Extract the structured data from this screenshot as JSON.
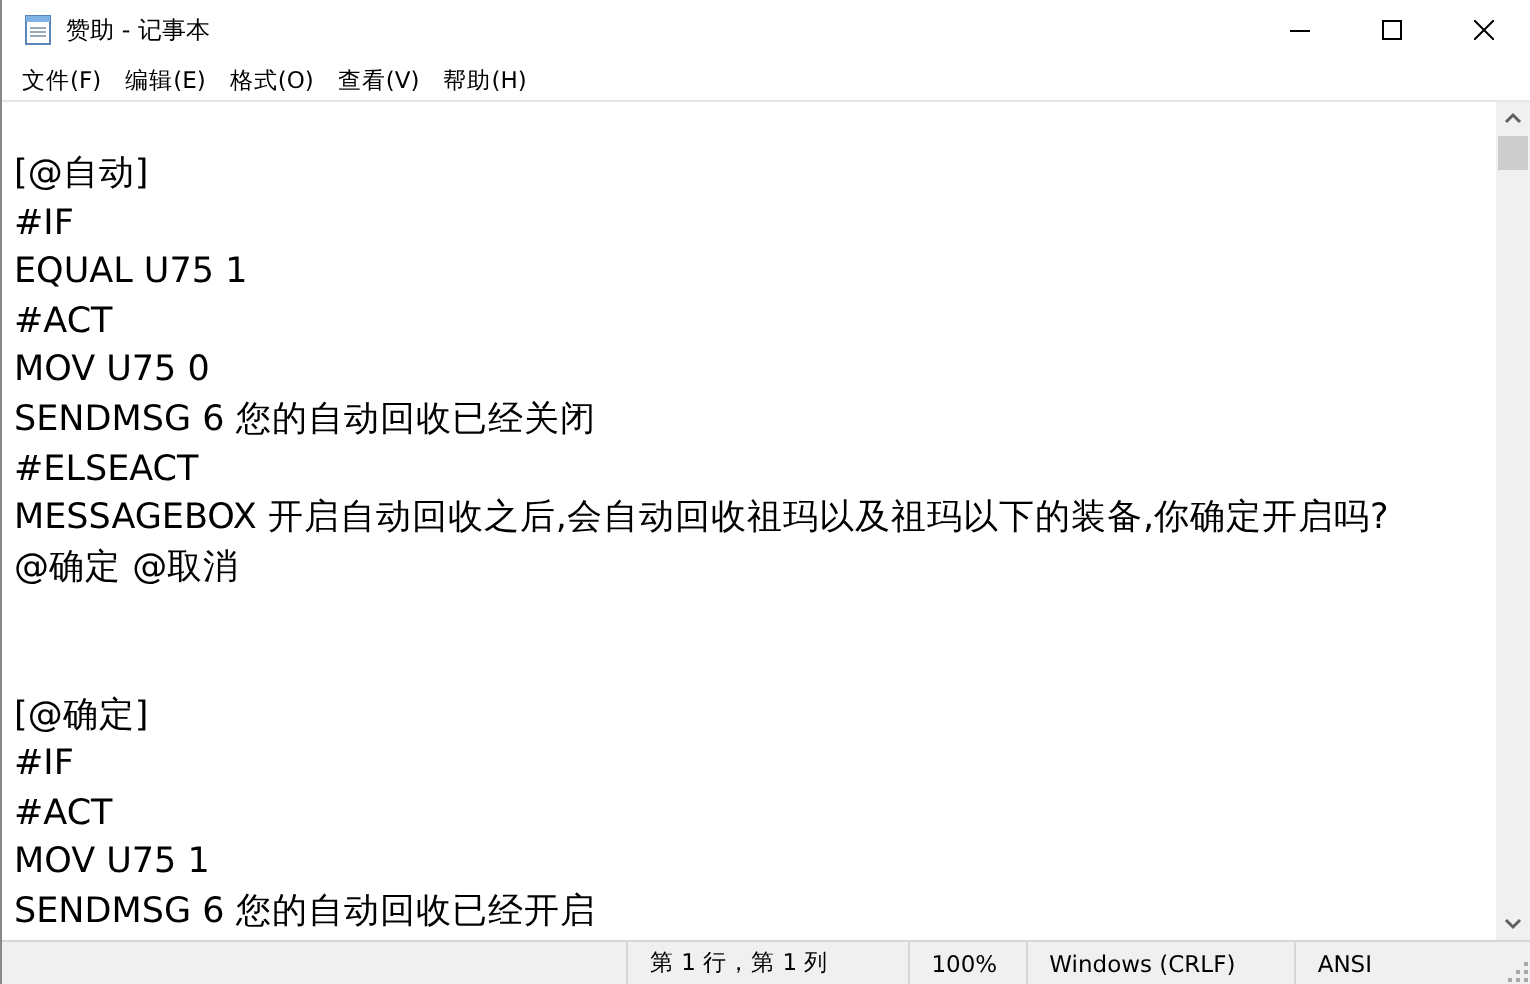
{
  "window": {
    "title": "赞助 - 记事本"
  },
  "menu": [
    "文件(F)",
    "编辑(E)",
    "格式(O)",
    "查看(V)",
    "帮助(H)"
  ],
  "blocks": [
    [
      "[@自动]",
      "#IF",
      "EQUAL U75 1",
      "#ACT",
      "MOV U75 0",
      "SENDMSG 6 您的自动回收已经关闭",
      "#ELSEACT",
      "MESSAGEBOX 开启自动回收之后,会自动回收祖玛以及祖玛以下的装备,你确定开启吗?",
      "@确定 @取消"
    ],
    [
      "[@确定]",
      "#IF",
      "#ACT",
      "MOV U75 1",
      "SENDMSG 6 您的自动回收已经开启"
    ]
  ],
  "status_bar": [
    "第 1 行，第 1 列",
    "100%",
    "Windows (CRLF)",
    "ANSI"
  ]
}
